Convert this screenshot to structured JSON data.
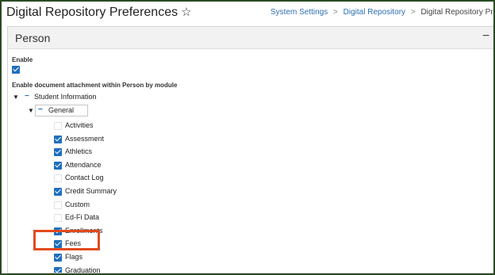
{
  "header": {
    "title": "Digital Repository Preferences",
    "star_icon": "star-outline-icon",
    "breadcrumb": [
      "System Settings",
      "Digital Repository",
      "Digital Repository Preference"
    ]
  },
  "panel": {
    "title": "Person",
    "collapse_symbol": "−",
    "enable_label": "Enable",
    "enable_checked": true,
    "module_heading": "Enable document attachment within Person by module"
  },
  "tree": {
    "root": {
      "label": "Student Information",
      "expanded": true
    },
    "group": {
      "label": "General",
      "expanded": true
    },
    "items": [
      {
        "label": "Activities",
        "checked": false
      },
      {
        "label": "Assessment",
        "checked": true
      },
      {
        "label": "Athletics",
        "checked": true
      },
      {
        "label": "Attendance",
        "checked": true
      },
      {
        "label": "Contact Log",
        "checked": false
      },
      {
        "label": "Credit Summary",
        "checked": true
      },
      {
        "label": "Custom",
        "checked": false
      },
      {
        "label": "Ed-Fi Data",
        "checked": false
      },
      {
        "label": "Enrollments",
        "checked": true
      },
      {
        "label": "Fees",
        "checked": true,
        "highlighted": true
      },
      {
        "label": "Flags",
        "checked": true
      },
      {
        "label": "Graduation",
        "checked": true
      }
    ]
  },
  "colors": {
    "accent": "#1f6fbf",
    "highlight": "#e24a1e",
    "outer": "#2a4a24"
  }
}
